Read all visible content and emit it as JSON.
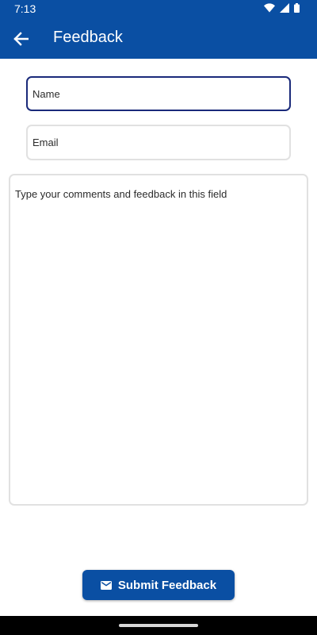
{
  "status_bar": {
    "time": "7:13",
    "icons": [
      "wifi-icon",
      "signal-icon",
      "battery-icon"
    ]
  },
  "toolbar": {
    "back_icon": "back-arrow-icon",
    "title": "Feedback",
    "background_color": "#0a4fa3"
  },
  "form": {
    "name": {
      "value": "",
      "placeholder": "Name"
    },
    "email": {
      "value": "",
      "placeholder": "Email"
    },
    "comments": {
      "value": "",
      "placeholder": "Type your comments and feedback in this field"
    }
  },
  "submit": {
    "icon": "mail-icon",
    "label": "Submit Feedback"
  },
  "colors": {
    "primary": "#0a4fa3",
    "focused_border": "#1a2a7a",
    "field_border": "#e1e1e1"
  }
}
